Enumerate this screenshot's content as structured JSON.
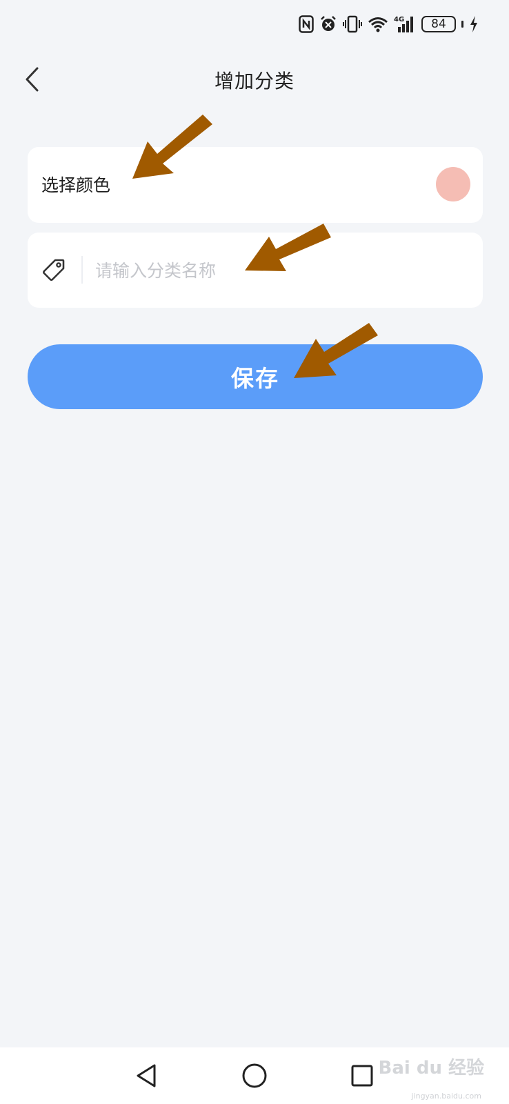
{
  "status_bar": {
    "battery_level": "84",
    "network_label": "4G",
    "icons": [
      "nfc-icon",
      "alarm-icon",
      "vibrate-icon",
      "wifi-icon",
      "signal-icon",
      "battery-icon",
      "charging-icon"
    ]
  },
  "header": {
    "title": "增加分类",
    "back_icon": "chevron-left-icon"
  },
  "color_picker": {
    "label": "选择颜色",
    "selected_color": "#f5bdb4"
  },
  "category_name": {
    "value": "",
    "placeholder": "请输入分类名称",
    "icon": "tag-icon"
  },
  "save_button": {
    "label": "保存",
    "color": "#5b9df9"
  },
  "annotation": {
    "arrow_color": "#a05a00"
  },
  "nav_bar": {
    "items": [
      "back-triangle-icon",
      "home-circle-icon",
      "recent-square-icon"
    ]
  },
  "watermark": {
    "brand": "Bai du 经验",
    "url": "jingyan.baidu.com"
  }
}
